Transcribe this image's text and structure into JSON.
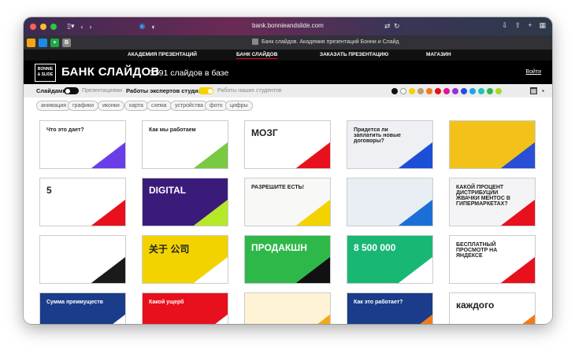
{
  "browser": {
    "url": "bank.bonnieandslide.com",
    "tab_title": "Банк слайдов. Академия презентаций Бонни и Слайд",
    "favicons": [
      "",
      "",
      "+",
      "B"
    ]
  },
  "site_nav": {
    "items": [
      "АКАДЕМИЯ ПРЕЗЕНТАЦИЙ",
      "БАНК СЛАЙДОВ",
      "ЗАКАЗАТЬ ПРЕЗЕНТАЦИЮ",
      "МАГАЗИН"
    ],
    "active": 1
  },
  "header": {
    "logo_line1": "BONNIE",
    "logo_line2": "& SLIDE",
    "title": "БАНК СЛАЙДОВ",
    "count": "3791 слайдов в базе",
    "login": "Войти"
  },
  "filters": {
    "slides": "Слайдами",
    "presentations": "Презентациями",
    "expert": "Работы экспертов студии",
    "students": "Работы наших студентов"
  },
  "colors": [
    "#111111",
    "#ffffff",
    "#f2d300",
    "#c49a6c",
    "#f07a1a",
    "#e8101c",
    "#e0139a",
    "#9b2fd6",
    "#2a4fd6",
    "#1ca5e8",
    "#1fc5b8",
    "#2fb84a",
    "#a8d82a"
  ],
  "tags": [
    "анимация",
    "графики",
    "иконки",
    "карта",
    "схема",
    "устройства",
    "фото",
    "цифры"
  ],
  "cards": [
    {
      "text": "Что это дает?",
      "bg": "#ffffff",
      "accent": "#6a3de8"
    },
    {
      "text": "Как мы работаем",
      "bg": "#ffffff",
      "accent": "#7ac943"
    },
    {
      "text": "МОЗГ",
      "bg": "#ffffff",
      "accent": "#e8101c"
    },
    {
      "text": "Придется ли заплатить новые договоры?",
      "bg": "#eef0f4",
      "accent": "#1c4fd6"
    },
    {
      "text": "",
      "bg": "#f3c21a",
      "accent": "#2a4fd6"
    },
    {
      "text": "5",
      "bg": "#ffffff",
      "accent": "#e8101c"
    },
    {
      "text": "DIGITAL",
      "bg": "#3a1b7a",
      "accent": "#b6e82a"
    },
    {
      "text": "РАЗРЕШИТЕ ЕСТЬ!",
      "bg": "#f8f8f6",
      "accent": "#f2d300"
    },
    {
      "text": "",
      "bg": "#e8eef4",
      "accent": "#1c6fd6"
    },
    {
      "text": "КАКОЙ ПРОЦЕНТ ДИСТРИБУЦИИ ЖВАЧКИ МЕНТОС В ГИПЕРМАРКЕТАХ?",
      "bg": "#f4f4f6",
      "accent": "#e8101c"
    },
    {
      "text": "",
      "bg": "#ffffff",
      "accent": "#1a1a1a"
    },
    {
      "text": "关于 公司",
      "bg": "#f2d300",
      "accent": "#ffffff"
    },
    {
      "text": "ПРОДАКШН",
      "bg": "#2fb84a",
      "accent": "#111111"
    },
    {
      "text": "8 500 000",
      "bg": "#18b874",
      "accent": "#ffffff"
    },
    {
      "text": "БЕСПЛАТНЫЙ ПРОСМОТР НА ЯНДЕКСЕ",
      "bg": "#ffffff",
      "accent": "#e8101c"
    },
    {
      "text": "Сумма преимуществ",
      "bg": "#1a3c8a",
      "accent": "#ffffff"
    },
    {
      "text": "Какой ущерб",
      "bg": "#e8101c",
      "accent": "#ffffff"
    },
    {
      "text": "",
      "bg": "#fff3d6",
      "accent": "#f2a81a"
    },
    {
      "text": "Как это работает?",
      "bg": "#1a3c8a",
      "accent": "#f07a1a"
    },
    {
      "text": "каждого",
      "bg": "#ffffff",
      "accent": "#f07a1a"
    }
  ]
}
